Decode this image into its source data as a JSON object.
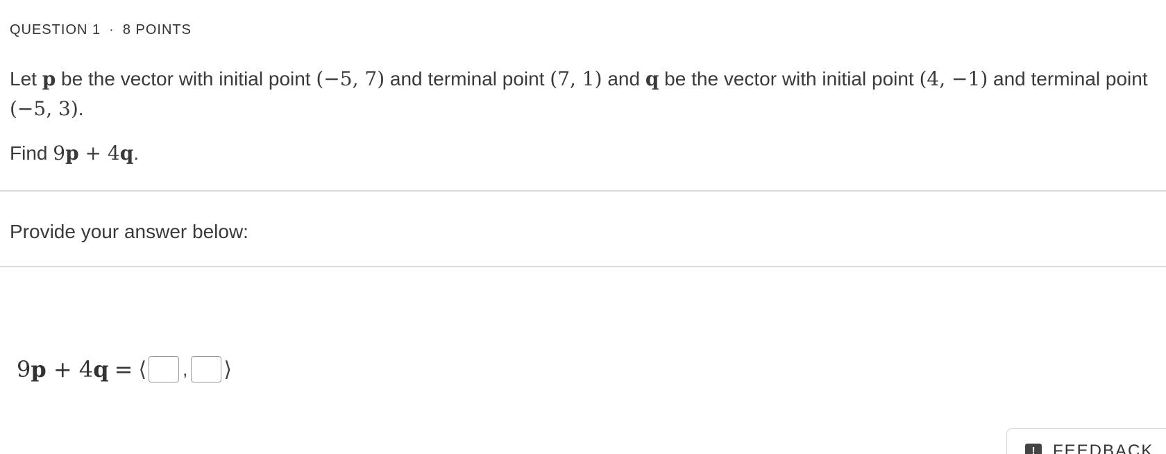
{
  "header": {
    "question": "QUESTION 1",
    "separator": "·",
    "points": "8 POINTS"
  },
  "prompt": {
    "t1": "Let ",
    "p": "p",
    "t2": " be the vector with initial point ",
    "p_initial": "(−5, 7)",
    "t3": " and terminal point ",
    "p_terminal": "(7, 1)",
    "t4": " and ",
    "q": "q",
    "t5": " be the vector with initial point ",
    "q_initial": "(4, −1)",
    "t6": " and terminal point ",
    "q_terminal": "(−5, 3)",
    "t7": "."
  },
  "find": {
    "label": "Find ",
    "coef1": "9",
    "p": "p",
    "plus": " + ",
    "coef2": "4",
    "q": "q",
    "period": "."
  },
  "provide_label": "Provide your answer below:",
  "answer": {
    "lhs_coef1": "9",
    "lhs_p": "p",
    "lhs_plus": " + ",
    "lhs_coef2": "4",
    "lhs_q": "q",
    "equals": "=",
    "open_angle": "⟨",
    "comma": ",",
    "close_angle": "⟩",
    "x_value": "",
    "y_value": ""
  },
  "feedback": {
    "icon": "!",
    "label": "FEEDBACK"
  }
}
